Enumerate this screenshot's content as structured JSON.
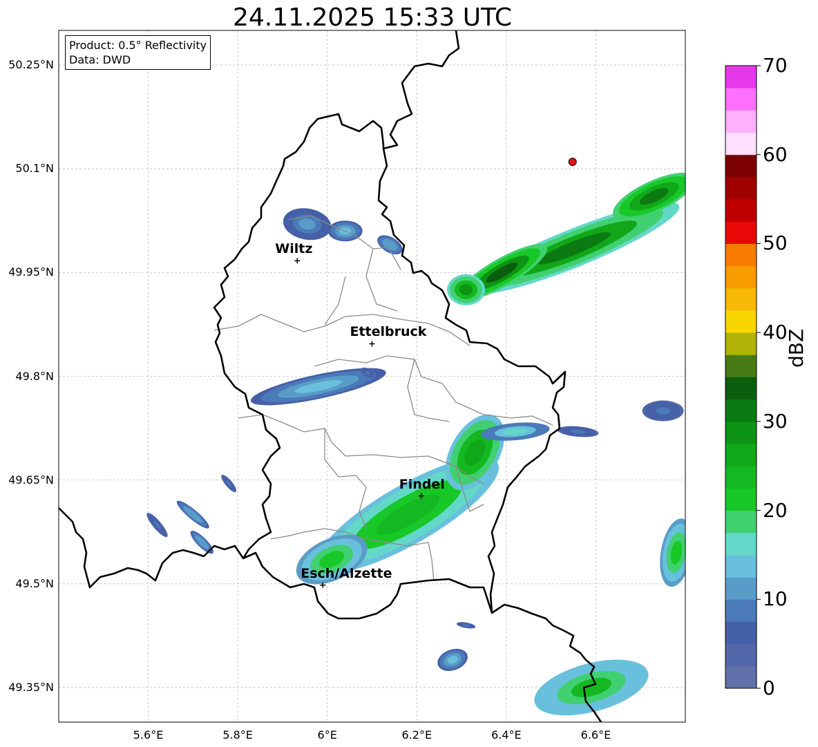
{
  "title": "24.11.2025 15:33 UTC",
  "info": {
    "product": "Product: 0.5° Reflectivity",
    "data": "Data: DWD"
  },
  "map": {
    "lon_range": [
      5.4,
      6.8
    ],
    "lat_range": [
      49.3,
      50.3
    ],
    "lon_ticks": [
      {
        "value": 5.6,
        "label": "5.6°E"
      },
      {
        "value": 5.8,
        "label": "5.8°E"
      },
      {
        "value": 6.0,
        "label": "6°E"
      },
      {
        "value": 6.2,
        "label": "6.2°E"
      },
      {
        "value": 6.4,
        "label": "6.4°E"
      },
      {
        "value": 6.6,
        "label": "6.6°E"
      }
    ],
    "lat_ticks": [
      {
        "value": 50.25,
        "label": "50.25°N"
      },
      {
        "value": 50.1,
        "label": "50.1°N"
      },
      {
        "value": 49.95,
        "label": "49.95°N"
      },
      {
        "value": 49.8,
        "label": "49.8°N"
      },
      {
        "value": 49.65,
        "label": "49.65°N"
      },
      {
        "value": 49.5,
        "label": "49.5°N"
      },
      {
        "value": 49.35,
        "label": "49.35°N"
      }
    ],
    "gridlines": true,
    "radar_site": {
      "lon": 6.548,
      "lat": 50.11,
      "color": "#e81010"
    },
    "cities": [
      {
        "name": "Wiltz",
        "lon": 5.933,
        "lat": 49.967
      },
      {
        "name": "Ettelbruck",
        "lon": 6.1,
        "lat": 49.847
      },
      {
        "name": "Findel",
        "lon": 6.21,
        "lat": 49.627
      },
      {
        "name": "Esch/Alzette",
        "lon": 5.99,
        "lat": 49.498
      }
    ],
    "precip_cells": [
      {
        "lon": 6.55,
        "lat": 49.985,
        "len": 330,
        "wid": 55,
        "angle": -22,
        "dbz": 30
      },
      {
        "lon": 6.39,
        "lat": 49.95,
        "len": 150,
        "wid": 40,
        "angle": -30,
        "dbz": 33
      },
      {
        "lon": 6.73,
        "lat": 50.06,
        "len": 130,
        "wid": 45,
        "angle": -25,
        "dbz": 32
      },
      {
        "lon": 6.31,
        "lat": 49.925,
        "len": 55,
        "wid": 45,
        "angle": 0,
        "dbz": 28
      },
      {
        "lon": 6.18,
        "lat": 49.6,
        "len": 300,
        "wid": 85,
        "angle": -30,
        "dbz": 24
      },
      {
        "lon": 6.33,
        "lat": 49.69,
        "len": 120,
        "wid": 70,
        "angle": -60,
        "dbz": 27
      },
      {
        "lon": 6.42,
        "lat": 49.72,
        "len": 100,
        "wid": 25,
        "angle": -5,
        "dbz": 15
      },
      {
        "lon": 6.01,
        "lat": 49.535,
        "len": 110,
        "wid": 60,
        "angle": -25,
        "dbz": 22
      },
      {
        "lon": 5.98,
        "lat": 49.785,
        "len": 200,
        "wid": 35,
        "angle": -12,
        "dbz": 13
      },
      {
        "lon": 5.955,
        "lat": 50.02,
        "len": 70,
        "wid": 45,
        "angle": 10,
        "dbz": 10
      },
      {
        "lon": 6.04,
        "lat": 50.01,
        "len": 50,
        "wid": 30,
        "angle": 0,
        "dbz": 13
      },
      {
        "lon": 6.14,
        "lat": 49.99,
        "len": 40,
        "wid": 22,
        "angle": 30,
        "dbz": 12
      },
      {
        "lon": 6.75,
        "lat": 49.75,
        "len": 60,
        "wid": 30,
        "angle": 0,
        "dbz": 8
      },
      {
        "lon": 6.56,
        "lat": 49.72,
        "len": 60,
        "wid": 15,
        "angle": 5,
        "dbz": 8
      },
      {
        "lon": 6.78,
        "lat": 49.545,
        "len": 100,
        "wid": 45,
        "angle": -80,
        "dbz": 22
      },
      {
        "lon": 6.59,
        "lat": 49.35,
        "len": 170,
        "wid": 70,
        "angle": -15,
        "dbz": 23
      },
      {
        "lon": 5.7,
        "lat": 49.6,
        "len": 60,
        "wid": 14,
        "angle": 40,
        "dbz": 12
      },
      {
        "lon": 5.62,
        "lat": 49.585,
        "len": 45,
        "wid": 12,
        "angle": 50,
        "dbz": 8
      },
      {
        "lon": 5.72,
        "lat": 49.56,
        "len": 45,
        "wid": 14,
        "angle": 45,
        "dbz": 12
      },
      {
        "lon": 5.78,
        "lat": 49.645,
        "len": 32,
        "wid": 10,
        "angle": 50,
        "dbz": 8
      },
      {
        "lon": 6.28,
        "lat": 49.39,
        "len": 45,
        "wid": 30,
        "angle": -20,
        "dbz": 13
      },
      {
        "lon": 6.31,
        "lat": 49.44,
        "len": 28,
        "wid": 8,
        "angle": 10,
        "dbz": 8
      },
      {
        "lon": 6.09,
        "lat": 49.805,
        "len": 22,
        "wid": 12,
        "angle": 30,
        "dbz": 8
      }
    ]
  },
  "colorbar": {
    "label": "dBZ",
    "min": 0,
    "max": 70,
    "ticks": [
      "0",
      "10",
      "20",
      "30",
      "40",
      "50",
      "60",
      "70"
    ],
    "colors": [
      "#6070a8",
      "#5268a8",
      "#4660a8",
      "#4a7ab8",
      "#5a9cc8",
      "#68c0dc",
      "#64d8c8",
      "#40d070",
      "#18c828",
      "#14b820",
      "#10a818",
      "#0e9414",
      "#0c7a12",
      "#0a5e0e",
      "#467a14",
      "#b0b208",
      "#f8d600",
      "#f8b808",
      "#f89c00",
      "#f87c00",
      "#e80808",
      "#c00000",
      "#a00000",
      "#7c0000",
      "#ffe0ff",
      "#ffb0ff",
      "#ff70ff",
      "#e838ec"
    ]
  }
}
